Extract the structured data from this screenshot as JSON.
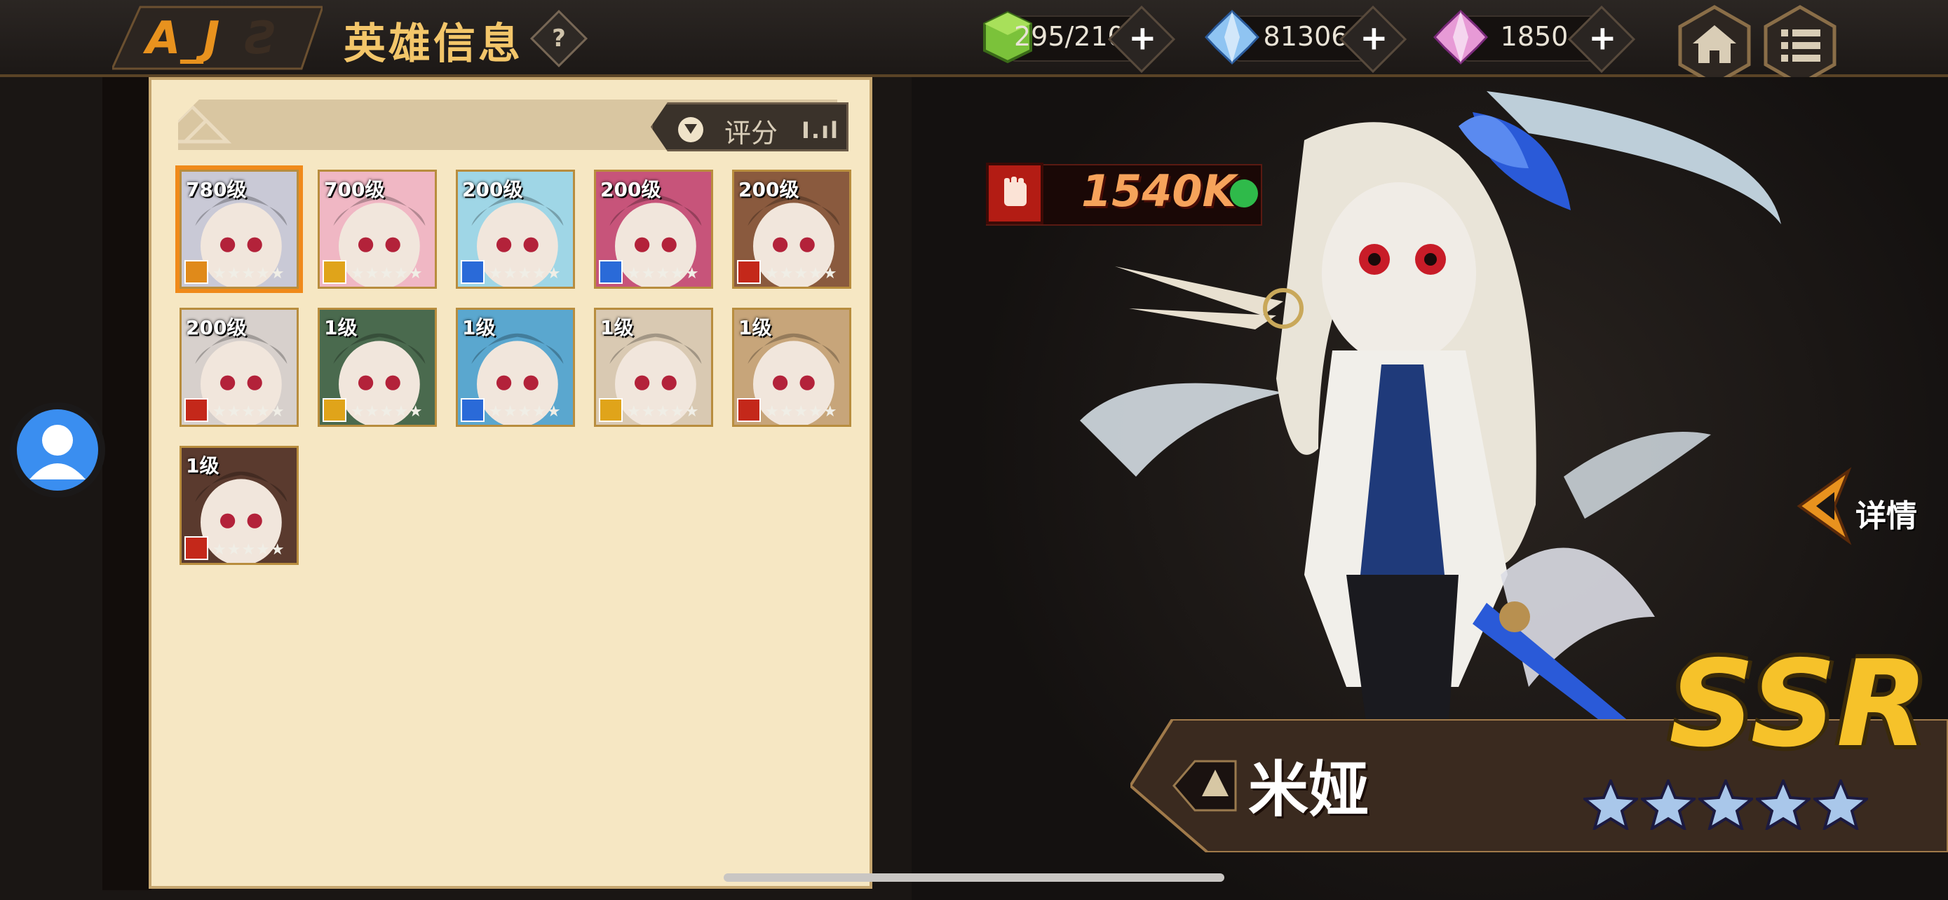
{
  "header": {
    "title": "英雄信息",
    "help_icon": "question-icon",
    "help_glyph": "?"
  },
  "resources": [
    {
      "name": "stamina",
      "icon": "green-cube-icon",
      "value": "295/2100",
      "plus": "+"
    },
    {
      "name": "diamond",
      "icon": "blue-crystal-icon",
      "value": "81306",
      "plus": "+"
    },
    {
      "name": "premium-gem",
      "icon": "pink-crystal-icon",
      "value": "1850",
      "plus": "+"
    }
  ],
  "nav": {
    "home_icon": "home-icon",
    "menu_icon": "menu-icon"
  },
  "filter": {
    "sort_label": "评分",
    "sort_bars": "Ⅰ.ıl",
    "filter_icon": "filter-icon"
  },
  "heroes": [
    {
      "level": "780级",
      "stars": "★★★★★",
      "class_color": "#e08a1a",
      "bg": "#c9c9d6",
      "selected": true
    },
    {
      "level": "700级",
      "stars": "★★★★★",
      "class_color": "#e0a41a",
      "bg": "#f0b7c4",
      "selected": false
    },
    {
      "level": "200级",
      "stars": "★★★★★",
      "class_color": "#2a6ad8",
      "bg": "#9fd6e6",
      "selected": false
    },
    {
      "level": "200级",
      "stars": "★★★★★",
      "class_color": "#2a6ad8",
      "bg": "#c7547a",
      "selected": false
    },
    {
      "level": "200级",
      "stars": "★★★★★",
      "class_color": "#c4281a",
      "bg": "#8a5a3e",
      "selected": false
    },
    {
      "level": "200级",
      "stars": "★★★★★",
      "class_color": "#c4281a",
      "bg": "#d7d0cc",
      "selected": false
    },
    {
      "level": "1级",
      "stars": "★★★★★",
      "class_color": "#e0a41a",
      "bg": "#4a6a4e",
      "selected": false
    },
    {
      "level": "1级",
      "stars": "★★★★★",
      "class_color": "#2a6ad8",
      "bg": "#5aa7cf",
      "selected": false
    },
    {
      "level": "1级",
      "stars": "★★★★★",
      "class_color": "#e0a41a",
      "bg": "#d9c9b2",
      "selected": false
    },
    {
      "level": "1级",
      "stars": "★★★★★",
      "class_color": "#c4281a",
      "bg": "#c7a57a",
      "selected": false
    },
    {
      "level": "1级",
      "stars": "★★★★★",
      "class_color": "#c4281a",
      "bg": "#5a3a2e",
      "selected": false
    }
  ],
  "hero_detail": {
    "power": "1540K",
    "power_icon": "fist-icon",
    "detail_label": "详情",
    "name": "米娅",
    "rarity": "SSR",
    "stars": 5,
    "class_icon": "class-emblem-icon"
  },
  "colors": {
    "accent": "#f3c66a",
    "panel": "#f6e7c3",
    "selected": "#f08a1a"
  }
}
